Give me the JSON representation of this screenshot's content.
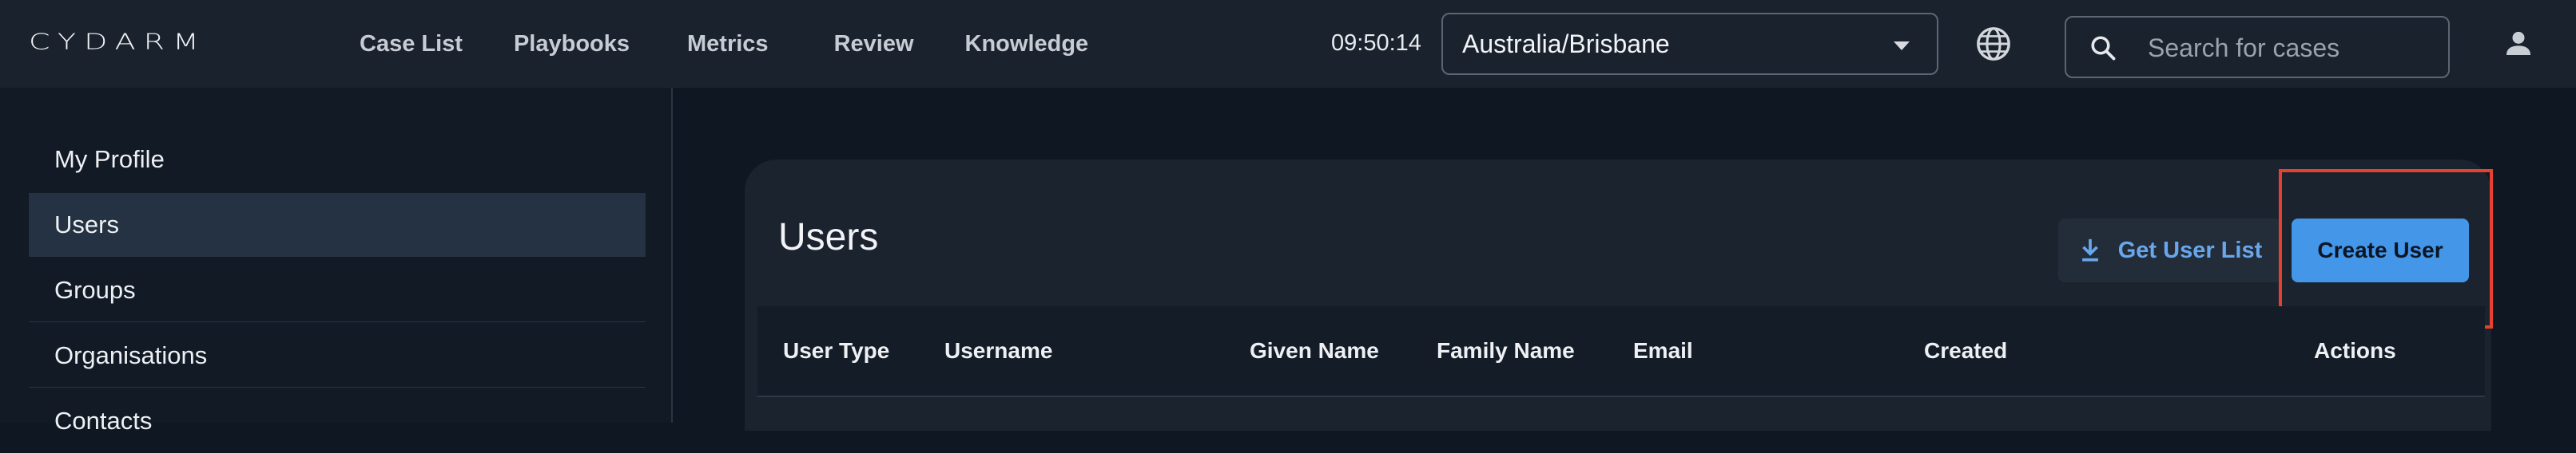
{
  "app": {
    "logo_text": "CYDARM"
  },
  "nav": {
    "items": [
      "Case List",
      "Playbooks",
      "Metrics",
      "Review",
      "Knowledge"
    ]
  },
  "header": {
    "clock": "09:50:14",
    "timezone": "Australia/Brisbane",
    "search_placeholder": "Search for cases"
  },
  "sidebar": {
    "items": [
      "My Profile",
      "Users",
      "Groups",
      "Organisations",
      "Contacts"
    ],
    "active": "Users"
  },
  "main": {
    "title": "Users",
    "get_user_list_label": "Get User List",
    "create_user_label": "Create User"
  },
  "table": {
    "columns": [
      "User Type",
      "Username",
      "Given Name",
      "Family Name",
      "Email",
      "Created",
      "Actions"
    ]
  },
  "colors": {
    "accent": "#4496e8",
    "highlight": "#e5412e",
    "background": "#0f1722"
  },
  "icons": [
    "globe-icon",
    "search-icon",
    "user-icon",
    "download-icon",
    "chevron-down-icon"
  ]
}
